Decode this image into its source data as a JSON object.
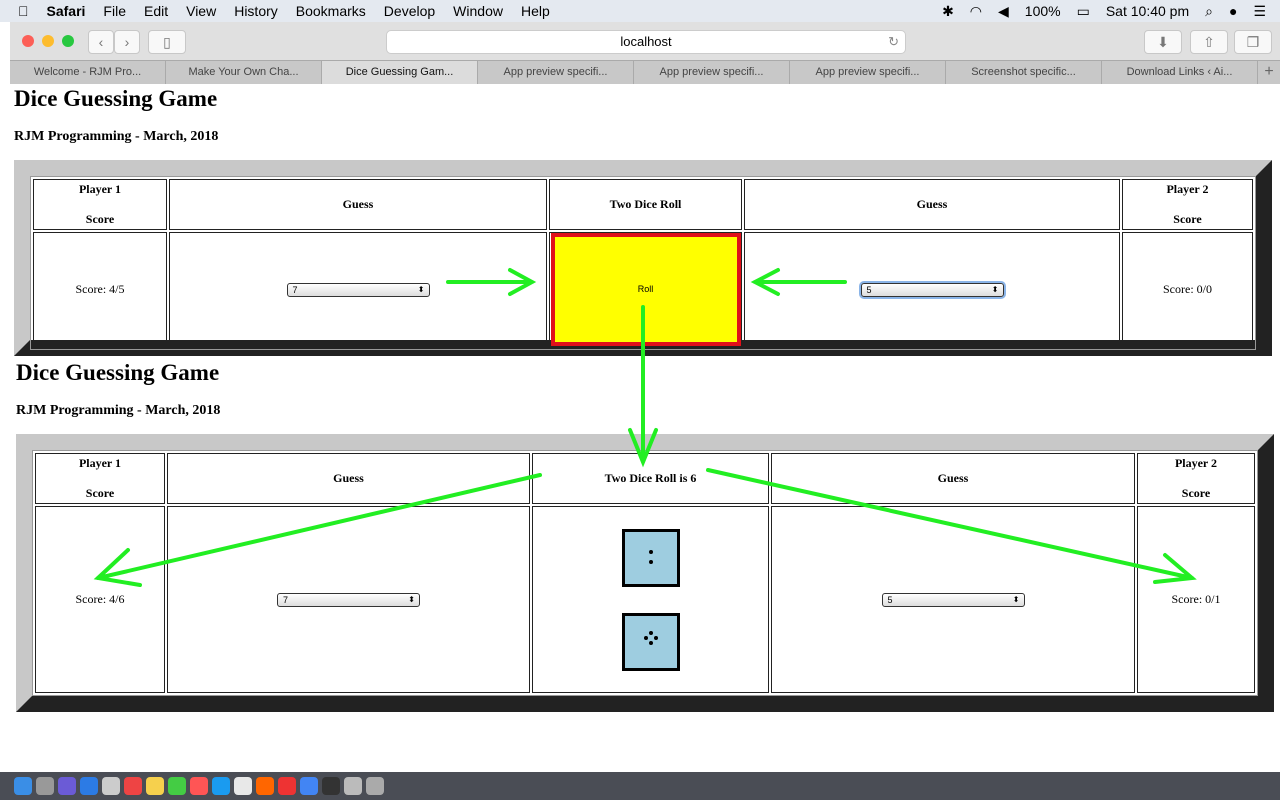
{
  "menubar": {
    "app": "Safari",
    "items": [
      "File",
      "Edit",
      "View",
      "History",
      "Bookmarks",
      "Develop",
      "Window",
      "Help"
    ],
    "battery": "100%",
    "clock": "Sat 10:40 pm"
  },
  "browser": {
    "url": "localhost",
    "tabs": [
      "Welcome - RJM Pro...",
      "Make Your Own Cha...",
      "Dice Guessing Gam...",
      "App preview specifi...",
      "App preview specifi...",
      "App preview specifi...",
      "Screenshot specific...",
      "Download Links ‹ Ai..."
    ],
    "active_tab": 2,
    "new_tab": "+"
  },
  "games": [
    {
      "title": "Dice Guessing Game",
      "subtitle": "RJM Programming - March, 2018",
      "p1_header": "Player 1",
      "score_label": "Score",
      "guess_header": "Guess",
      "roll_header": "Two Dice Roll",
      "p2_header": "Player 2",
      "p1_score": "Score: 4/5",
      "p1_guess": "7",
      "roll_button": "Roll",
      "p2_guess": "5",
      "p2_score": "Score: 0/0"
    },
    {
      "title": "Dice Guessing Game",
      "subtitle": "RJM Programming - March, 2018",
      "p1_header": "Player 1",
      "score_label": "Score",
      "guess_header": "Guess",
      "roll_header": "Two Dice Roll is 6",
      "p2_header": "Player 2",
      "p1_score": "Score: 4/6",
      "p1_guess": "7",
      "p2_guess": "5",
      "p2_score": "Score: 0/1",
      "dice": [
        2,
        4
      ]
    }
  ],
  "colors": {
    "arrow": "#22ee22",
    "roll_bg": "#ffff00",
    "roll_border": "#e0101a",
    "die_bg": "#9ecde0"
  }
}
